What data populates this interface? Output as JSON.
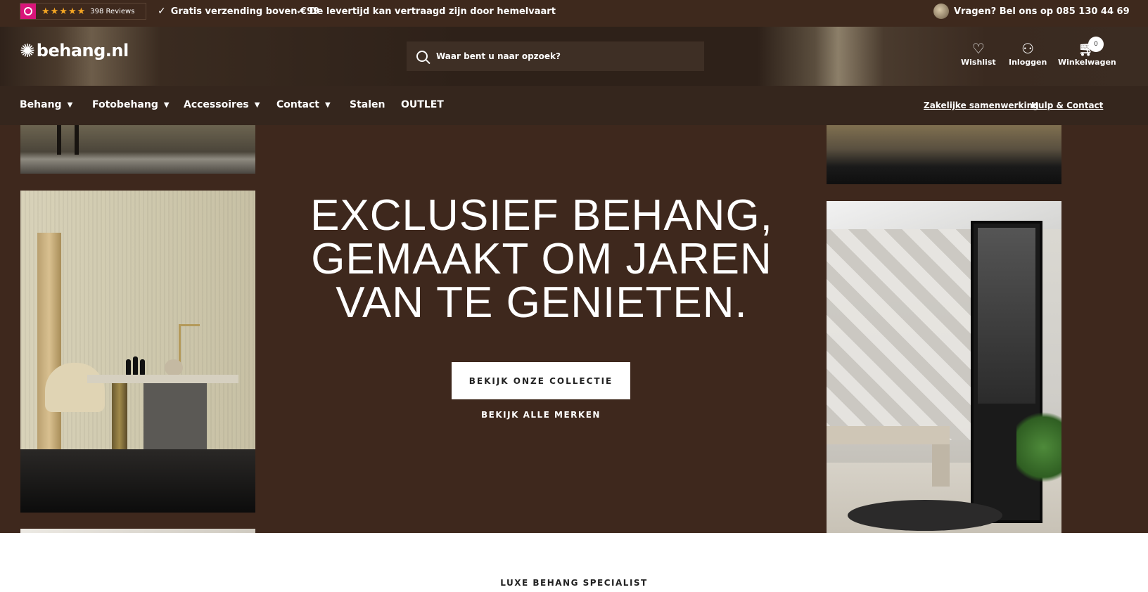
{
  "topbar": {
    "rating_reviews": "398 Reviews",
    "stars": "★★★★★",
    "usp_1": "Gratis verzending boven €99",
    "usp_2": "De levertijd kan vertraagd zijn door hemelvaart",
    "phone": "Vragen? Bel ons op 085 130 44 69",
    "check_glyph": "✓"
  },
  "header": {
    "logo_text": "behang.nl",
    "search_placeholder": "Waar bent u naar opzoek?",
    "wishlist_label": "Wishlist",
    "login_label": "Inloggen",
    "cart_label": "Winkelwagen",
    "cart_count": "0"
  },
  "nav": {
    "items": [
      {
        "label": "Behang",
        "has_dropdown": true
      },
      {
        "label": "Fotobehang",
        "has_dropdown": true
      },
      {
        "label": "Accessoires",
        "has_dropdown": true
      },
      {
        "label": "Contact",
        "has_dropdown": true
      },
      {
        "label": "Stalen",
        "has_dropdown": false
      },
      {
        "label": "OUTLET",
        "has_dropdown": false
      }
    ],
    "right_links": [
      "Zakelijke samenwerking",
      "Hulp & Contact"
    ]
  },
  "hero": {
    "headline_line_1": "EXCLUSIEF BEHANG,",
    "headline_line_2": "GEMAAKT OM JAREN",
    "headline_line_3": "VAN TE GENIETEN.",
    "cta_label": "BEKIJK ONZE COLLECTIE",
    "secondary_link": "BEKIJK ALLE MERKEN"
  },
  "section": {
    "eyebrow": "LUXE BEHANG SPECIALIST"
  },
  "colors": {
    "topbar_bg": "#3e291d",
    "hero_bg": "#3e281d",
    "nav_bg": "#35261d",
    "star": "#f5a623",
    "kiyoh_brand": "#d9157a"
  },
  "icons": [
    "kiyoh-logo-icon",
    "star-icon",
    "check-icon",
    "search-icon",
    "heart-icon",
    "user-icon",
    "cart-icon",
    "chevron-down-icon"
  ]
}
